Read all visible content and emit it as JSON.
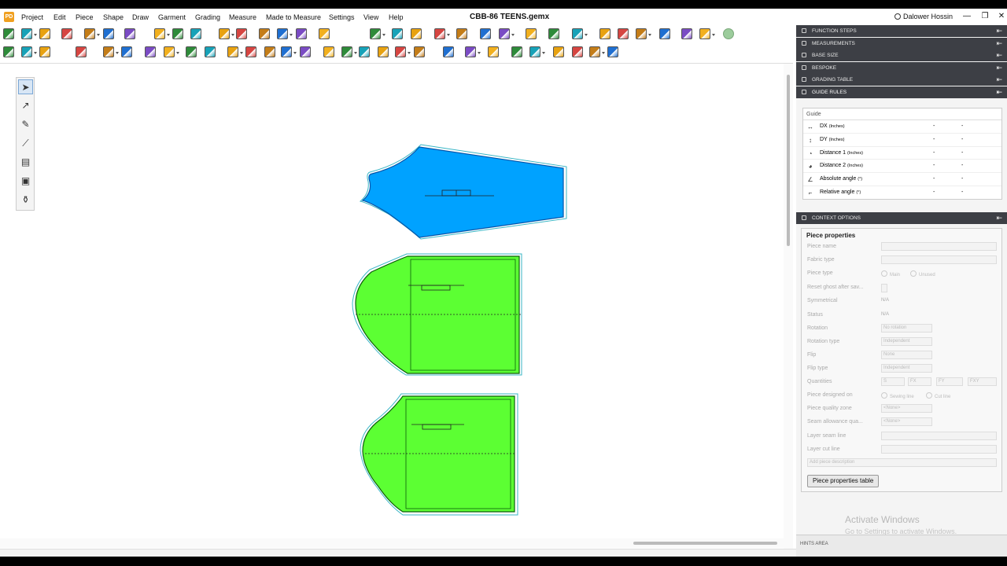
{
  "app": {
    "title": "CBB-86 TEENS.gemx",
    "logo": "PD",
    "user": "Dalower Hossin",
    "window_controls": [
      "—",
      "❐",
      "✕"
    ]
  },
  "menu": [
    "Project",
    "Edit",
    "Piece",
    "Shape",
    "Draw",
    "Garment",
    "Grading",
    "Measure",
    "Made to Measure",
    "Settings",
    "View",
    "Help"
  ],
  "colors": {
    "piece_blue": "#00a2ff",
    "piece_green": "#5cff33",
    "panel_header": "#3d3f45"
  },
  "toolbar1_icons": [
    "new-icon",
    "open-icon",
    "open-old-icon",
    "save-icon",
    "export-icon",
    "undo-icon",
    "redo-icon",
    "zoom-fit-icon",
    "zoom-window-icon",
    "zoom-in-icon",
    "select-piece-icon",
    "layers-icon",
    "multi-piece-icon",
    "move-icon",
    "transform-icon",
    "forward-icon",
    "add-piece-icon",
    "grid-icon",
    "view-icon",
    "align-icon",
    "snap-icon",
    "measure-icon",
    "piece-info-icon",
    "grade-icon",
    "cut-icon",
    "tools-icon",
    "table-icon",
    "sheet-icon",
    "print-icon",
    "plot-icon",
    "id-card-icon",
    "screen-icon",
    "help-icon"
  ],
  "toolbar2_icons": [
    "folder-icon",
    "document-icon",
    "node-icon",
    "color-wheel-icon",
    "add-notch-icon",
    "replace-icon",
    "copy-icon",
    "rotate-icon",
    "shape1-icon",
    "shape2-icon",
    "lock-icon",
    "frame-icon",
    "delete-icon",
    "copy-piece-icon",
    "tag-icon",
    "mirror-icon",
    "flip-icon",
    "cycle-icon",
    "scale-icon",
    "resize-icon",
    "align-piece-icon",
    "stack-icon",
    "walk-icon",
    "arrow-icon",
    "forward2-icon",
    "split-icon",
    "piece-tag-icon",
    "cut-line-icon",
    "arrange-icon",
    "marker-icon"
  ],
  "left_tools": [
    "arrow-select-icon",
    "curve-select-icon",
    "pencil-icon",
    "pen-icon",
    "ruler-icon",
    "briefcase-icon",
    "paint-icon"
  ],
  "right_panel": {
    "sections": [
      "FUNCTION STEPS",
      "MEASUREMENTS",
      "BASE SIZE",
      "BESPOKE",
      "GRADING TABLE",
      "GUIDE RULES"
    ],
    "guide_header": "Guide",
    "guide_rows": [
      {
        "label": "DX",
        "unit": "(Inches)",
        "v1": "-",
        "v2": "-",
        "icon": "dx-icon"
      },
      {
        "label": "DY",
        "unit": "(Inches)",
        "v1": "-",
        "v2": "-",
        "icon": "dy-icon"
      },
      {
        "label": "Distance 1",
        "unit": "(Inches)",
        "v1": "-",
        "v2": "-",
        "icon": "distance1-icon"
      },
      {
        "label": "Distance 2",
        "unit": "(Inches)",
        "v1": "-",
        "v2": "-",
        "icon": "distance2-icon"
      },
      {
        "label": "Absolute angle",
        "unit": "(°)",
        "v1": "-",
        "v2": "-",
        "icon": "absolute-angle-icon"
      },
      {
        "label": "Relative angle",
        "unit": "(°)",
        "v1": "-",
        "v2": "-",
        "icon": "relative-angle-icon"
      }
    ],
    "context_header": "CONTEXT OPTIONS",
    "piece_properties_title": "Piece properties",
    "props": {
      "piece_name": "Piece name",
      "fabric_type": "Fabric type",
      "piece_type": "Piece type",
      "piece_type_main": "Main",
      "piece_type_unused": "Unused",
      "reset_ghost": "Reset ghost after sav...",
      "symmetrical": "Symmetrical",
      "symmetrical_value": "N/A",
      "status": "Status",
      "status_value": "N/A",
      "rotation": "Rotation",
      "rotation_value": "No rotation",
      "rotation_type": "Rotation type",
      "rotation_type_value": "Independent",
      "flip": "Flip",
      "flip_value": "None",
      "flip_type": "Flip type",
      "flip_type_value": "Independent",
      "quantities": "Quantities",
      "q_s": "S",
      "q_fx": "FX",
      "q_fy": "FY",
      "q_fxy": "FXY",
      "designed_on": "Piece designed on",
      "designed_sewing": "Sewing line",
      "designed_cut": "Cut line",
      "quality_zone": "Piece quality zone",
      "quality_zone_value": "<None>",
      "seam_allowance": "Seam allowance qua...",
      "seam_allowance_value": "<None>",
      "layer_seam": "Layer seam line",
      "layer_cut": "Layer cut line",
      "description_placeholder": "Add piece description"
    },
    "properties_button": "Piece properties table",
    "hints": "HINTS AREA"
  },
  "watermark": {
    "line1": "Activate Windows",
    "line2": "Go to Settings to activate Windows."
  }
}
